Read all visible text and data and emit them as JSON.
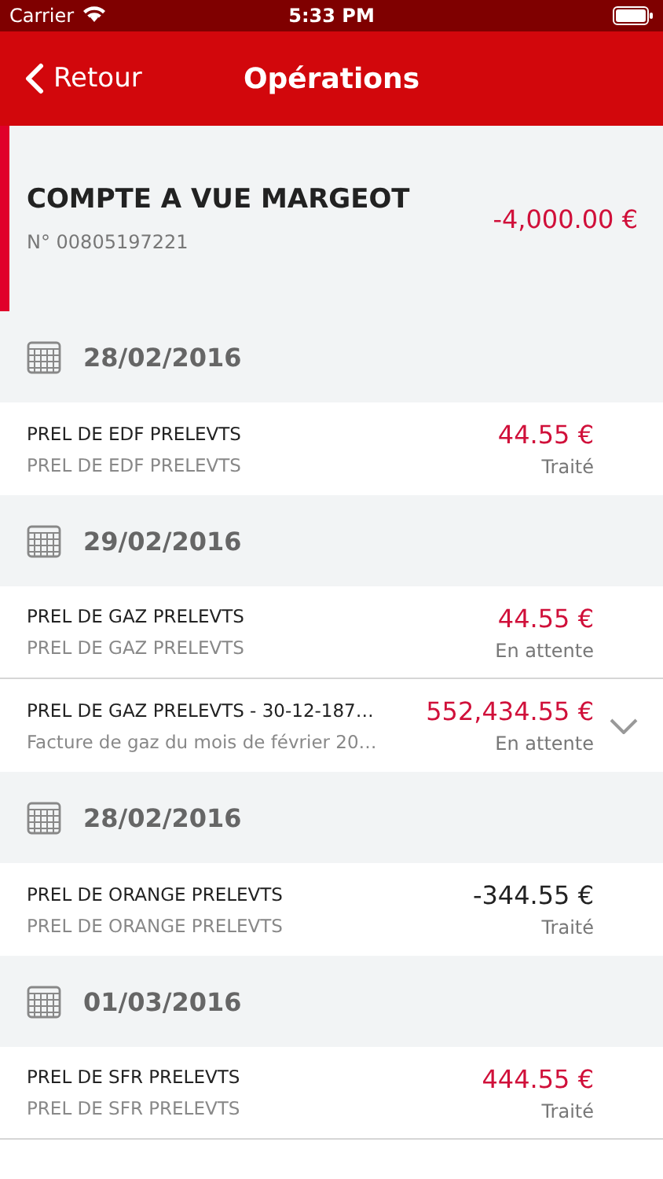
{
  "status_bar": {
    "carrier": "Carrier",
    "time": "5:33 PM"
  },
  "nav": {
    "back": "Retour",
    "title": "Opérations"
  },
  "account": {
    "name": "COMPTE A VUE MARGEOT",
    "number": "N° 00805197221",
    "balance": "-4,000.00 €",
    "color": "#d0103a"
  },
  "groups": [
    {
      "date": "28/02/2016",
      "operations": [
        {
          "label": "PREL DE EDF PRELEVTS",
          "detail": "PREL DE EDF PRELEVTS",
          "amount": "44.55 €",
          "color": "#d0103a",
          "status": "Traité",
          "expandable": false
        }
      ]
    },
    {
      "date": "29/02/2016",
      "operations": [
        {
          "label": "PREL DE GAZ PRELEVTS",
          "detail": "PREL DE GAZ PRELEVTS",
          "amount": "44.55 €",
          "color": "#d0103a",
          "status": "En attente",
          "expandable": false
        },
        {
          "label": "PREL DE GAZ PRELEVTS - 30-12-187…",
          "detail": "Facture de gaz du mois de février 20…",
          "amount": "552,434.55 €",
          "color": "#d0103a",
          "status": "En attente",
          "expandable": true
        }
      ]
    },
    {
      "date": "28/02/2016",
      "operations": [
        {
          "label": "PREL DE ORANGE PRELEVTS",
          "detail": "PREL DE ORANGE PRELEVTS",
          "amount": "-344.55 €",
          "color": "#222222",
          "status": "Traité",
          "expandable": false
        }
      ]
    },
    {
      "date": "01/03/2016",
      "operations": [
        {
          "label": "PREL DE SFR PRELEVTS",
          "detail": "PREL DE SFR PRELEVTS",
          "amount": "444.55 €",
          "color": "#d0103a",
          "status": "Traité",
          "expandable": false
        }
      ]
    }
  ]
}
